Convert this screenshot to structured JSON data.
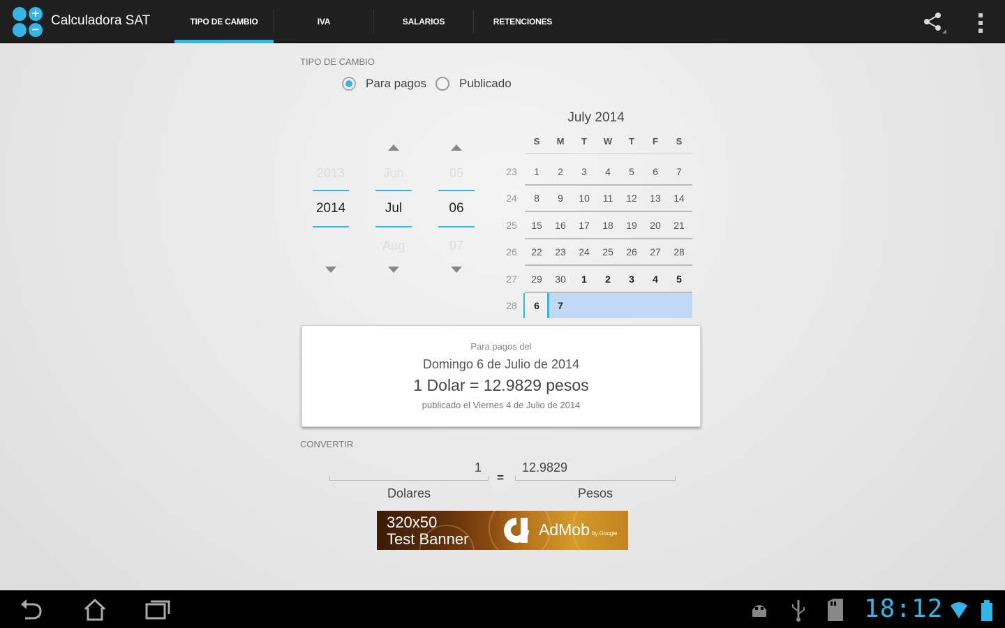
{
  "app": {
    "title": "Calculadora SAT",
    "logo_plus": "+",
    "logo_minus": "−"
  },
  "tabs": [
    {
      "label": "TIPO DE CAMBIO",
      "active": true
    },
    {
      "label": "IVA",
      "active": false
    },
    {
      "label": "SALARIOS",
      "active": false
    },
    {
      "label": "RETENCIONES",
      "active": false
    }
  ],
  "actions": {
    "share_icon": "share-icon",
    "overflow_icon": "overflow-menu-icon"
  },
  "exchange": {
    "section_label": "TIPO DE CAMBIO",
    "radio_para_pagos": "Para pagos",
    "radio_publicado": "Publicado",
    "selected_radio": "Para pagos"
  },
  "date_picker": {
    "year": {
      "prev": "2013",
      "current": "2014",
      "next": ""
    },
    "month": {
      "prev": "Jun",
      "current": "Jul",
      "next": "Aug"
    },
    "day": {
      "prev": "05",
      "current": "06",
      "next": "07"
    }
  },
  "calendar": {
    "title": "July 2014",
    "weekdays": [
      "S",
      "M",
      "T",
      "W",
      "T",
      "F",
      "S"
    ],
    "weeks": [
      {
        "num": "23",
        "days": [
          "1",
          "2",
          "3",
          "4",
          "5",
          "6",
          "7"
        ]
      },
      {
        "num": "24",
        "days": [
          "8",
          "9",
          "10",
          "11",
          "12",
          "13",
          "14"
        ]
      },
      {
        "num": "25",
        "days": [
          "15",
          "16",
          "17",
          "18",
          "19",
          "20",
          "21"
        ]
      },
      {
        "num": "26",
        "days": [
          "22",
          "23",
          "24",
          "25",
          "26",
          "27",
          "28"
        ]
      },
      {
        "num": "27",
        "days": [
          "29",
          "30",
          "1",
          "2",
          "3",
          "4",
          "5"
        ]
      },
      {
        "num": "28",
        "days": [
          "6",
          "7",
          "",
          "",
          "",
          "",
          ""
        ]
      }
    ],
    "selected_day": "6"
  },
  "result": {
    "line1": "Para pagos del",
    "line2": "Domingo 6 de Julio de 2014",
    "line3": "1 Dolar = 12.9829 pesos",
    "line4": "publicado el Viernes 4 de Julio de 2014"
  },
  "converter": {
    "section_label": "CONVERTIR",
    "dolares_value": "1",
    "pesos_value": "12.9829",
    "equals": "=",
    "dolares_label": "Dolares",
    "pesos_label": "Pesos"
  },
  "ad": {
    "size_text": "320x50",
    "test_text": "Test Banner",
    "brand": "AdMob",
    "brand_sub": "by Google"
  },
  "system_bar": {
    "clock": "18:12"
  },
  "colors": {
    "accent": "#33b5e5",
    "action_bar": "#1f1f1f",
    "calendar_selection": "#c2d9f6"
  }
}
